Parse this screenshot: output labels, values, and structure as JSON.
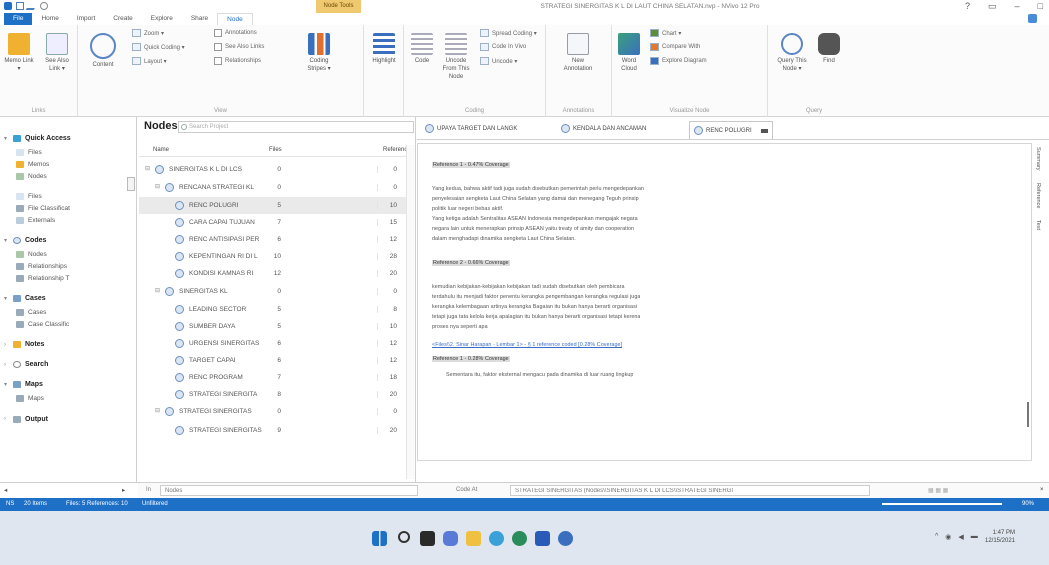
{
  "window": {
    "title": "STRATEGI SINERGITAS K L DI LAUT CHINA SELATAN.nvp - NVivo 12 Pro",
    "context_tab": "Node Tools",
    "controls": [
      "–",
      "□",
      "×"
    ]
  },
  "tabs": [
    "File",
    "Home",
    "Import",
    "Create",
    "Explore",
    "Share",
    "Node"
  ],
  "ribbon": {
    "memo_link": "Memo Link ▾",
    "see_also_link": "See Also Link ▾",
    "links_group": "Links",
    "content": "Content",
    "zoom": "Zoom ▾",
    "quick_coding": "Quick Coding ▾",
    "layout": "Layout ▾",
    "annotations": "Annotations",
    "see_also_links": "See Also Links",
    "relationships": "Relationships",
    "view_group": "View",
    "coding_stripes": "Coding Stripes ▾",
    "highlight": "Highlight",
    "code": "Code",
    "uncode_from": "Uncode From This Node",
    "spread_coding": "Spread Coding ▾",
    "code_in_vivo": "Code In Vivo",
    "uncode": "Uncode ▾",
    "coding_group": "Coding",
    "new_annotation": "New Annotation",
    "annotations_group": "Annotations",
    "word_cloud": "Word Cloud",
    "chart": "Chart ▾",
    "compare_with": "Compare With",
    "explore_diagram": "Explore Diagram",
    "visualize_group": "Visualize Node",
    "query_this_node": "Query This Node ▾",
    "find": "Find",
    "query_group": "Query"
  },
  "nav": {
    "quick_access": "Quick Access",
    "files": "Files",
    "memos": "Memos",
    "nodes": "Nodes",
    "files2": "Files",
    "file_classifications": "File Classificat",
    "externals": "Externals",
    "codes": "Codes",
    "codes_nodes": "Nodes",
    "relationships": "Relationships",
    "relationship_types": "Relationship T",
    "cases": "Cases",
    "cases_item": "Cases",
    "case_classifications": "Case Classific",
    "notes": "Notes",
    "search": "Search",
    "maps": "Maps",
    "maps_item": "Maps",
    "output": "Output"
  },
  "nodes_pane": {
    "title": "Nodes",
    "search_placeholder": "Search Project",
    "col_name": "Name",
    "col_files": "Files",
    "col_refs": "Referenc",
    "rows": [
      {
        "name": "SINERGITAS K L DI LCS",
        "files": "0",
        "refs": "0"
      },
      {
        "name": "RENCANA STRATEGI KL",
        "files": "0",
        "refs": "0"
      },
      {
        "name": "RENC POLUGRI",
        "files": "5",
        "refs": "10"
      },
      {
        "name": "CARA CAPAI TUJUAN",
        "files": "7",
        "refs": "15"
      },
      {
        "name": "RENC ANTISIPASI PER",
        "files": "6",
        "refs": "12"
      },
      {
        "name": "KEPENTINGAN RI DI L",
        "files": "10",
        "refs": "28"
      },
      {
        "name": "KONDISI KAMNAS RI",
        "files": "12",
        "refs": "20"
      },
      {
        "name": "SINERGITAS KL",
        "files": "0",
        "refs": "0"
      },
      {
        "name": "LEADING SECTOR",
        "files": "5",
        "refs": "8"
      },
      {
        "name": "SUMBER DAYA",
        "files": "5",
        "refs": "10"
      },
      {
        "name": "URGENSI SINERGITAS",
        "files": "6",
        "refs": "12"
      },
      {
        "name": "TARGET CAPAI",
        "files": "6",
        "refs": "12"
      },
      {
        "name": "RENC PROGRAM",
        "files": "7",
        "refs": "18"
      },
      {
        "name": "STRATEGI SINERGITA",
        "files": "8",
        "refs": "20"
      },
      {
        "name": "STRATEGI SINERGITAS",
        "files": "0",
        "refs": "0"
      },
      {
        "name": "STRATEGI SINERGITAS",
        "files": "9",
        "refs": "20"
      }
    ]
  },
  "detail": {
    "tabs": [
      "UPAYA TARGET DAN LANGK",
      "KENDALA DAN ANCAMAN",
      "RENC POLUGRI"
    ],
    "side_tabs": [
      "Summary",
      "Reference",
      "Text"
    ],
    "lines": [
      {
        "text": "Reference 1 - 0.47% Coverage",
        "kind": "ref"
      },
      {
        "text": "Yang kedua, bahwa aktif tadi juga sudah disebutkan pemerintah perlu mengedepankan",
        "kind": "text"
      },
      {
        "text": "penyelesaian sengketa Laut China Selatan yang damai dan menegang Teguh prinsip",
        "kind": "text"
      },
      {
        "text": "politik luar negeri bebas aktif.",
        "kind": "text"
      },
      {
        "text": "Yang ketiga adalah Sentralitas ASEAN Indonesia mengedepankan mengajak negara",
        "kind": "text"
      },
      {
        "text": "negara lain untuk menerapkan prinsip ASEAN yaitu treaty of amity dan cooperation",
        "kind": "text"
      },
      {
        "text": "dalam menghadapi dinamika sengketa Laut China Selatan.",
        "kind": "text"
      },
      {
        "text": "Reference 2 - 0.66% Coverage",
        "kind": "ref"
      },
      {
        "text": "kemudian kebijakan-kebijakan kebijakan tadi sudah disebutkan oleh pembicara",
        "kind": "text"
      },
      {
        "text": "terdahulu itu menjadi faktor penentu kerangka pengembangan kerangka regulasi juga",
        "kind": "text"
      },
      {
        "text": "kerangka kelembagaan artinya kerangka Bagaian itu bukan hanya berarti organisasi",
        "kind": "text"
      },
      {
        "text": "tetapi juga tata kelola kerja apalagian itu bukan hanya berarti organisasi tetapi kerena",
        "kind": "text"
      },
      {
        "text": "proses nya seperti apa",
        "kind": "text"
      },
      {
        "text": "<Files\\\\2. Sinar Harapan - Lembar 1> - § 1 reference coded [0.28% Coverage]",
        "kind": "link"
      },
      {
        "text": "Reference 1 - 0.28% Coverage",
        "kind": "ref"
      },
      {
        "text": "Sementara itu, faktor eksternal mengacu pada dinamika di luar ruang lingkup",
        "kind": "text"
      }
    ]
  },
  "codebar": {
    "in_label": "In",
    "in_value": "Nodes",
    "code_at": "Code At",
    "code_at_value": "STRATEGI SINERGITAS (Nodes\\\\SINERGITAS K L DI LCS\\\\STRATEGI SINERGI"
  },
  "status": {
    "user": "NS",
    "items": "20 Items",
    "files_refs": "Files: 5  References: 10",
    "unfiltered": "Unfiltered",
    "zoom": "90%"
  },
  "taskbar": {
    "time": "1:47 PM",
    "date": "12/15/2021"
  },
  "colors": {
    "accent": "#1e6fc6",
    "context_tab": "#f0c870"
  }
}
